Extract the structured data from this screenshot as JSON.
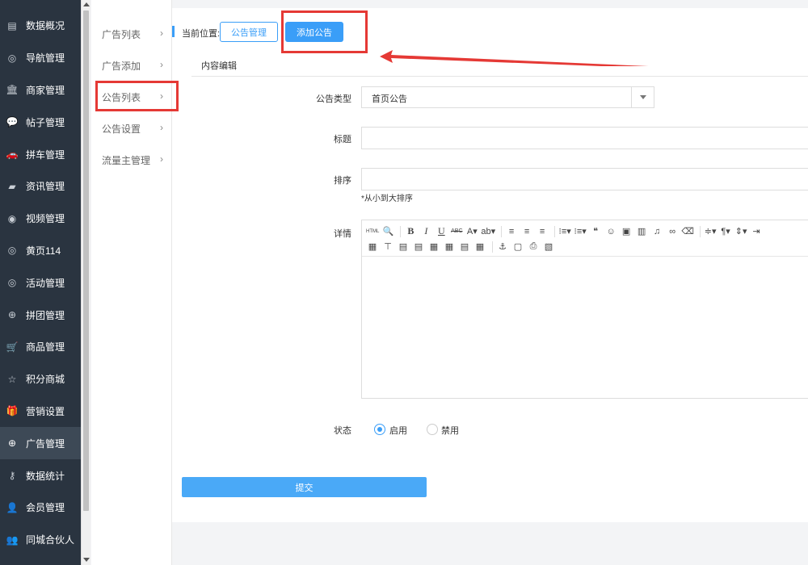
{
  "sidebar": {
    "items": [
      {
        "label": "数据概况",
        "icon": "dashboard-icon",
        "glyph": "▤"
      },
      {
        "label": "导航管理",
        "icon": "compass-icon",
        "glyph": "◎"
      },
      {
        "label": "商家管理",
        "icon": "bank-icon",
        "glyph": "🏛"
      },
      {
        "label": "帖子管理",
        "icon": "comment-icon",
        "glyph": "💬"
      },
      {
        "label": "拼车管理",
        "icon": "car-icon",
        "glyph": "🚗"
      },
      {
        "label": "资讯管理",
        "icon": "book-icon",
        "glyph": "▰"
      },
      {
        "label": "视频管理",
        "icon": "video-icon",
        "glyph": "◉"
      },
      {
        "label": "黄页114",
        "icon": "compass-icon",
        "glyph": "◎"
      },
      {
        "label": "活动管理",
        "icon": "compass-icon",
        "glyph": "◎"
      },
      {
        "label": "拼团管理",
        "icon": "globe-icon",
        "glyph": "⊕"
      },
      {
        "label": "商品管理",
        "icon": "cart-icon",
        "glyph": "🛒"
      },
      {
        "label": "积分商城",
        "icon": "star-icon",
        "glyph": "☆"
      },
      {
        "label": "营销设置",
        "icon": "gift-icon",
        "glyph": "🎁"
      },
      {
        "label": "广告管理",
        "icon": "globe-icon",
        "glyph": "⊕",
        "active": true
      },
      {
        "label": "数据统计",
        "icon": "key-icon",
        "glyph": "⚷"
      },
      {
        "label": "会员管理",
        "icon": "user-icon",
        "glyph": "👤"
      },
      {
        "label": "同城合伙人",
        "icon": "users-icon",
        "glyph": "👥"
      }
    ]
  },
  "submenu": {
    "items": [
      {
        "label": "广告列表",
        "chev": "›"
      },
      {
        "label": "广告添加",
        "chev": "›"
      },
      {
        "label": "公告列表",
        "chev": "›"
      },
      {
        "label": "公告设置",
        "chev": "›"
      },
      {
        "label": "流量主管理",
        "chev": "›"
      }
    ]
  },
  "breadcrumb": {
    "label": "当前位置:",
    "tab_notice": "公告管理",
    "tab_add": "添加公告"
  },
  "form": {
    "section_title": "内容编辑",
    "type_label": "公告类型",
    "type_value": "首页公告",
    "title_label": "标题",
    "title_value": "",
    "sort_label": "排序",
    "sort_value": "",
    "sort_hint": "*从小到大排序",
    "detail_label": "详情",
    "status_label": "状态",
    "status_on": "启用",
    "status_off": "禁用",
    "submit": "提交"
  },
  "editor": {
    "toolbar_row1": [
      {
        "name": "html-source-icon",
        "glyph": "HTML",
        "cls": "small"
      },
      {
        "name": "preview-icon",
        "glyph": "🔍"
      },
      {
        "sep": true
      },
      {
        "name": "bold-icon",
        "glyph": "B",
        "cls": "bold"
      },
      {
        "name": "italic-icon",
        "glyph": "I",
        "cls": "ital"
      },
      {
        "name": "underline-icon",
        "glyph": "U",
        "cls": "und"
      },
      {
        "name": "strikethrough-icon",
        "glyph": "ABC",
        "cls": "strike"
      },
      {
        "name": "font-color-icon",
        "glyph": "A▾"
      },
      {
        "name": "highlight-icon",
        "glyph": "ab▾"
      },
      {
        "sep": true
      },
      {
        "name": "align-left-icon",
        "glyph": "≡"
      },
      {
        "name": "align-center-icon",
        "glyph": "≡"
      },
      {
        "name": "align-right-icon",
        "glyph": "≡"
      },
      {
        "sep": true
      },
      {
        "name": "ordered-list-icon",
        "glyph": "⁝≡▾"
      },
      {
        "name": "unordered-list-icon",
        "glyph": "⁝≡▾"
      },
      {
        "name": "quote-icon",
        "glyph": "❝"
      },
      {
        "name": "emoji-icon",
        "glyph": "☺"
      },
      {
        "name": "image-icon",
        "glyph": "▣"
      },
      {
        "name": "video-icon",
        "glyph": "▥"
      },
      {
        "name": "music-icon",
        "glyph": "♫"
      },
      {
        "name": "link-icon",
        "glyph": "∞"
      },
      {
        "name": "eraser-icon",
        "glyph": "⌫"
      },
      {
        "sep": true
      },
      {
        "name": "line-height-icon",
        "glyph": "≑▾"
      },
      {
        "name": "paragraph-icon",
        "glyph": "¶▾"
      },
      {
        "name": "row-spacing-icon",
        "glyph": "⇕▾"
      },
      {
        "name": "indent-icon",
        "glyph": "⇥"
      }
    ],
    "toolbar_row2": [
      {
        "name": "insert-column-icon",
        "glyph": "▦"
      },
      {
        "name": "merge-cells-icon",
        "glyph": "⊤"
      },
      {
        "name": "table-icon",
        "glyph": "▤"
      },
      {
        "name": "table-row-icon",
        "glyph": "▤"
      },
      {
        "name": "table-col-icon",
        "glyph": "▦"
      },
      {
        "name": "table-merge-icon",
        "glyph": "▦"
      },
      {
        "name": "table-split-icon",
        "glyph": "▤"
      },
      {
        "name": "table-delete-icon",
        "glyph": "▦"
      },
      {
        "sep": true
      },
      {
        "name": "anchor-icon",
        "glyph": "⚓"
      },
      {
        "name": "page-break-icon",
        "glyph": "▢"
      },
      {
        "name": "print-icon",
        "glyph": "⎙"
      },
      {
        "name": "template-icon",
        "glyph": "▧"
      }
    ]
  },
  "colors": {
    "accent": "#3a9ef8",
    "sidebar_bg": "#2a3440",
    "annotation": "#e53935"
  }
}
